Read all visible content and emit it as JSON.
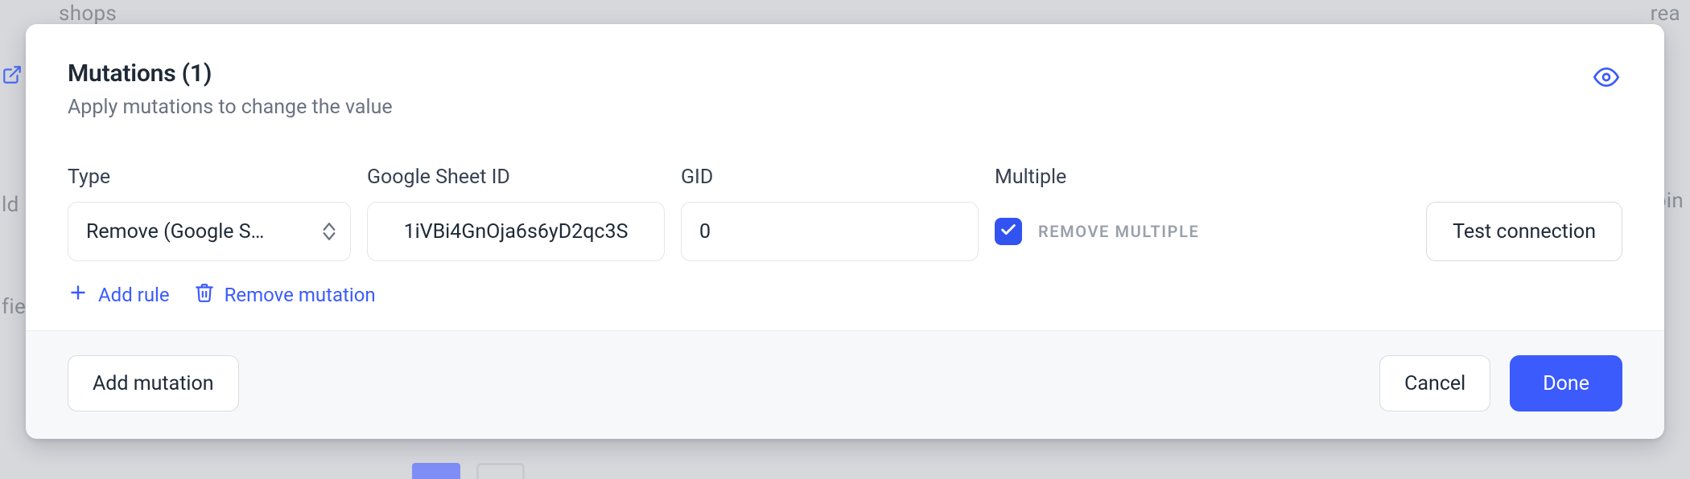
{
  "header": {
    "title": "Mutations (1)",
    "subtitle": "Apply mutations to change the value"
  },
  "fields": {
    "type": {
      "label": "Type",
      "value": "Remove (Google S…"
    },
    "sheet": {
      "label": "Google Sheet ID",
      "value": "1iVBi4GnOja6s6yD2qc3S"
    },
    "gid": {
      "label": "GID",
      "value": "0"
    },
    "multiple": {
      "label": "Multiple",
      "checkbox_label": "REMOVE MULTIPLE",
      "checked": true
    },
    "test_connection": "Test connection"
  },
  "links": {
    "add_rule": "Add rule",
    "remove_mutation": "Remove mutation"
  },
  "footer": {
    "add_mutation": "Add mutation",
    "cancel": "Cancel",
    "done": "Done"
  },
  "bg": {
    "tl": "shops",
    "tr": "rea",
    "m1": "ld",
    "m2": "fie",
    "mr": "oin"
  }
}
